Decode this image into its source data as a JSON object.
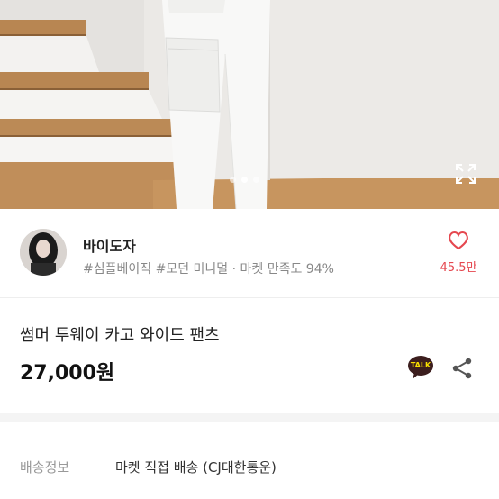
{
  "hero": {
    "image_icon": "product-photo-image",
    "expand_icon": "expand-icon",
    "page_dots": 3,
    "active_dot": 1
  },
  "seller": {
    "name": "바이도자",
    "tags": "#심플베이직 #모던 미니멀 · 마켓 만족도 94%",
    "avatar_icon": "avatar",
    "like_icon": "heart-icon",
    "like_count": "45.5만"
  },
  "product": {
    "title": "썸머 투웨이 카고 와이드 팬츠",
    "price": "27,000원",
    "talk_icon": "kakaotalk-icon",
    "talk_label": "TALK",
    "share_icon": "share-icon"
  },
  "shipping": {
    "label": "배송정보",
    "value": "마켓 직접 배송 (CJ대한통운)"
  },
  "colors": {
    "accent": "#e5474f",
    "talk_bg": "#3c1e1e",
    "talk_text": "#f9e000"
  }
}
